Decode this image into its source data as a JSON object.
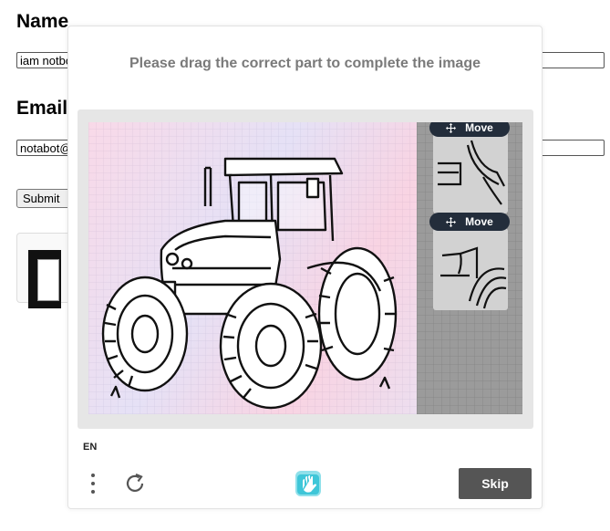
{
  "form": {
    "name_label": "Name",
    "name_value": "iam notbot",
    "email_label": "Email",
    "email_value": "notabot@",
    "submit_label": "Submit"
  },
  "captcha": {
    "prompt": "Please drag the correct part to complete the image",
    "pieces": [
      {
        "move_label": "Move"
      },
      {
        "move_label": "Move"
      }
    ],
    "language": "EN",
    "skip_label": "Skip",
    "colors": {
      "move_pill": "#232d3b",
      "skip_button": "#555555",
      "prompt_text": "#7a7a7a",
      "logo": "#3ec6d8"
    },
    "icons": [
      "move-icon",
      "more-options-icon",
      "refresh-icon",
      "hcaptcha-logo-icon"
    ]
  }
}
